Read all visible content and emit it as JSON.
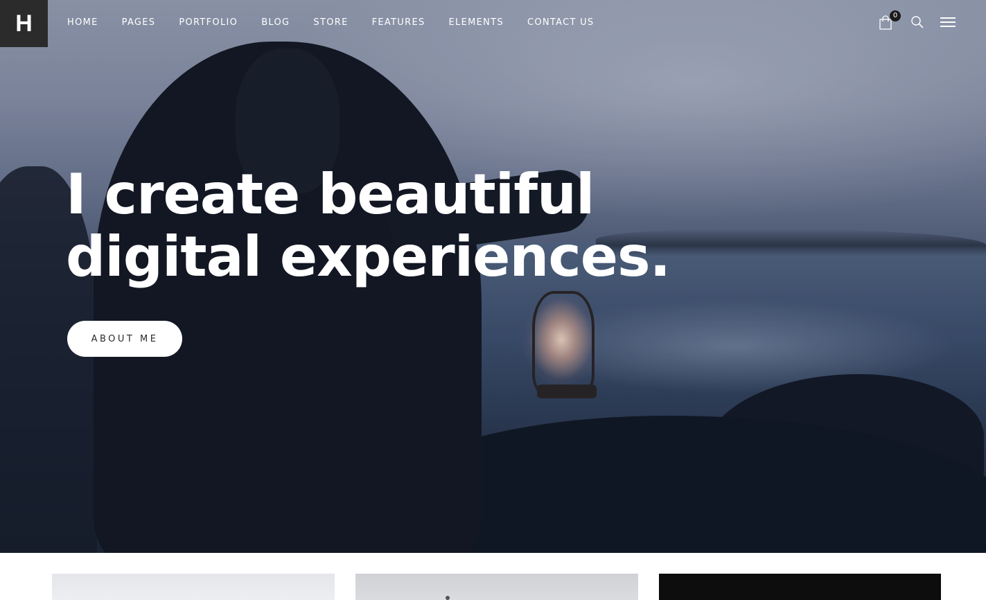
{
  "header": {
    "logo_letter": "H",
    "nav": [
      {
        "label": "HOME"
      },
      {
        "label": "PAGES"
      },
      {
        "label": "PORTFOLIO"
      },
      {
        "label": "BLOG"
      },
      {
        "label": "STORE"
      },
      {
        "label": "FEATURES"
      },
      {
        "label": "ELEMENTS"
      },
      {
        "label": "CONTACT US"
      }
    ],
    "cart_count": "0",
    "icons": [
      "shopping-bag-icon",
      "search-icon",
      "hamburger-menu-icon"
    ]
  },
  "hero": {
    "headline_line1": "I create beautiful",
    "headline_line2": "digital experiences.",
    "cta_label": "ABOUT ME"
  },
  "colors": {
    "logo_bg": "#2b2b2b",
    "text_light": "#ffffff",
    "button_bg": "#ffffff",
    "button_text": "#2a2a2a"
  }
}
